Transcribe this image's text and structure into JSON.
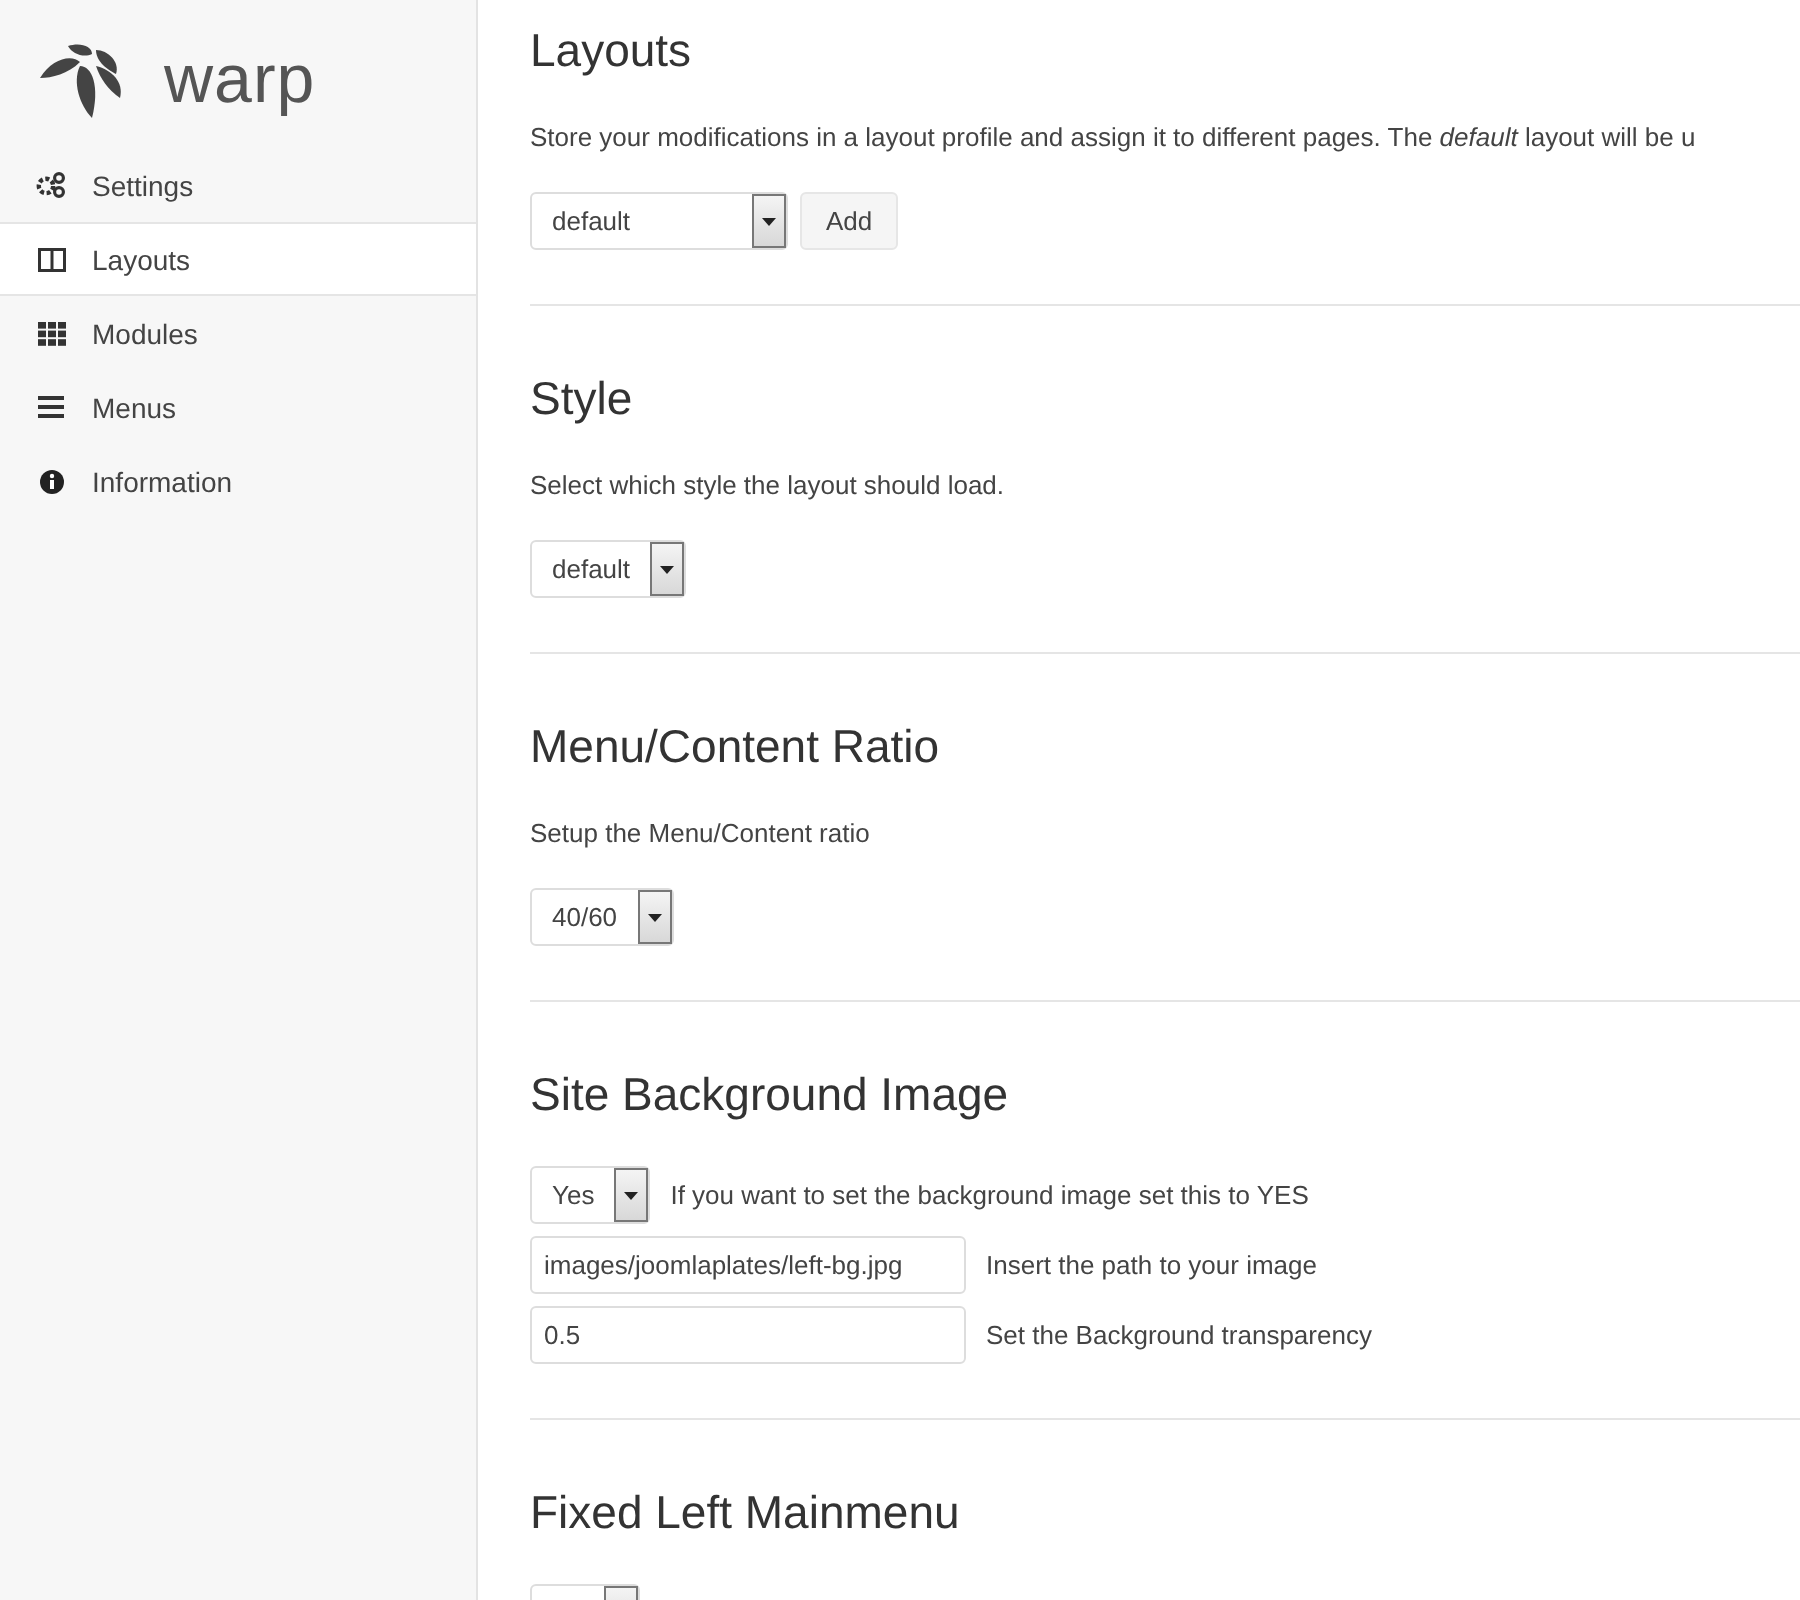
{
  "logo": {
    "text": "warp"
  },
  "sidebar": {
    "items": [
      {
        "label": "Settings",
        "selected": false
      },
      {
        "label": "Layouts",
        "selected": true
      },
      {
        "label": "Modules",
        "selected": false
      },
      {
        "label": "Menus",
        "selected": false
      },
      {
        "label": "Information",
        "selected": false
      }
    ]
  },
  "sections": [
    {
      "title": "Layouts",
      "description": "Store your modifications in a layout profile and assign it to different pages. The *default* layout will be u",
      "rows": [
        {
          "controls": [
            {
              "kind": "select",
              "value": "default"
            },
            {
              "kind": "button",
              "label": "Add"
            }
          ]
        }
      ]
    },
    {
      "title": "Style",
      "description": "Select which style the layout should load.",
      "rows": [
        {
          "controls": [
            {
              "kind": "select",
              "value": "default"
            }
          ]
        }
      ]
    },
    {
      "title": "Menu/Content Ratio",
      "description": "Setup the Menu/Content ratio",
      "rows": [
        {
          "controls": [
            {
              "kind": "select",
              "value": "40/60"
            }
          ]
        }
      ]
    },
    {
      "title": "Site Background Image",
      "rows": [
        {
          "controls": [
            {
              "kind": "select",
              "value": "Yes"
            }
          ],
          "hint": "If you want to set the background image set this to YES"
        },
        {
          "controls": [
            {
              "kind": "input",
              "value": "images/joomlaplates/left-bg.jpg"
            }
          ],
          "hint": "Insert the path to your image"
        },
        {
          "controls": [
            {
              "kind": "input",
              "value": "0.5"
            }
          ],
          "hint": "Set the Background transparency"
        }
      ]
    },
    {
      "title": "Fixed Left Mainmenu",
      "rows": [
        {
          "controls": [
            {
              "kind": "select"
            }
          ]
        }
      ]
    }
  ]
}
